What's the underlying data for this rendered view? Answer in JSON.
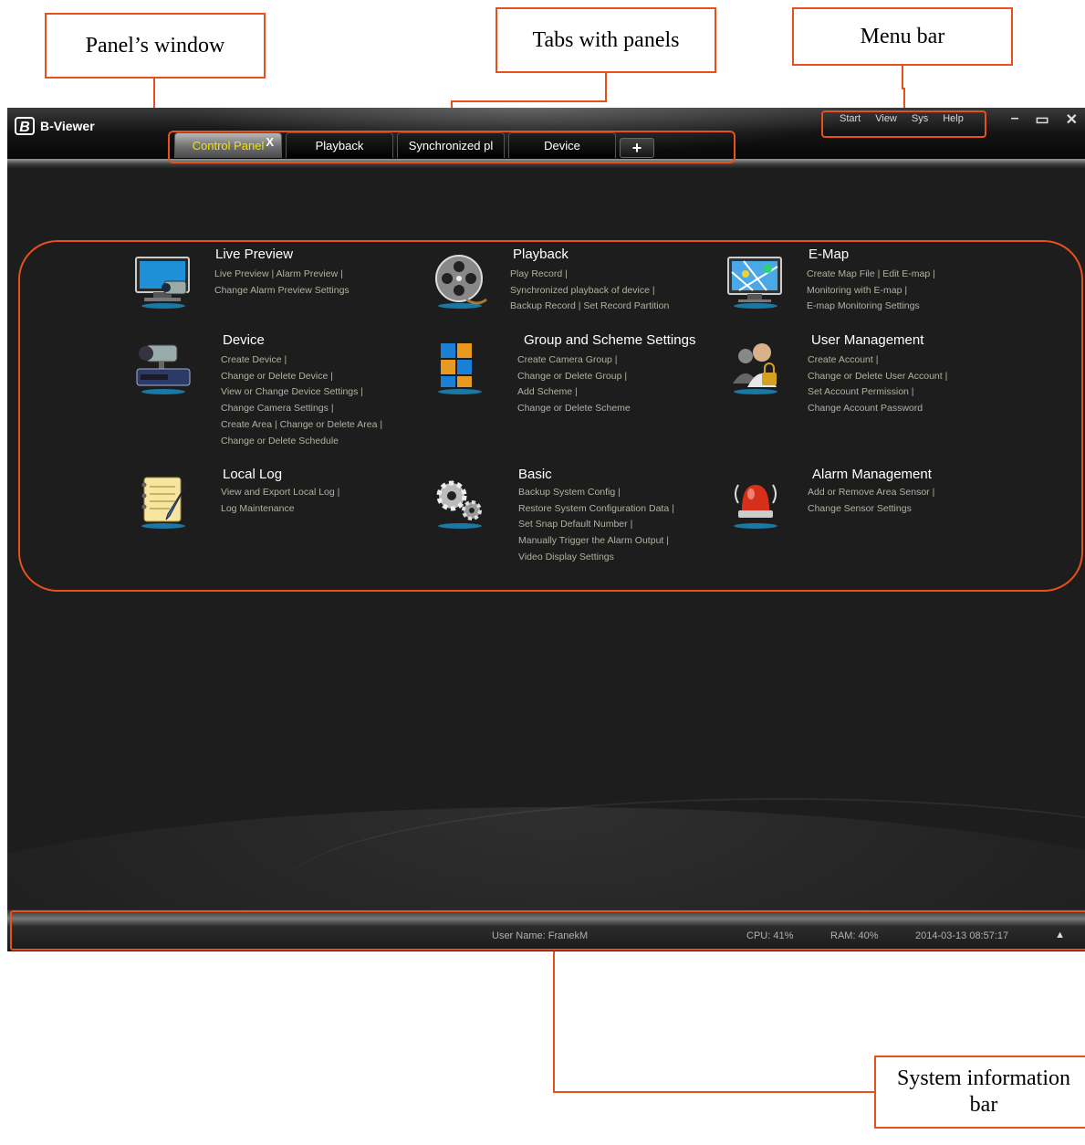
{
  "annotations": {
    "panel_window": "Panel’s window",
    "tabs": "Tabs with panels",
    "menu_bar": "Menu bar",
    "system_info_line1": "System information",
    "system_info_line2": "bar"
  },
  "app": {
    "logo_letter": "B",
    "title": "B-Viewer",
    "menu": [
      "Start",
      "View",
      "Sys",
      "Help"
    ],
    "window_controls": [
      "–",
      "▭",
      "✕"
    ],
    "tabs": [
      {
        "label": "Control Panel",
        "active": true,
        "close": "X"
      },
      {
        "label": "Playback"
      },
      {
        "label": "Synchronized pl"
      },
      {
        "label": "Device"
      }
    ],
    "add_tab": "+"
  },
  "modules": [
    {
      "title": "Live Preview",
      "icon": "monitor-camera-icon",
      "links": [
        "Live Preview  |  Alarm Preview  |",
        "Change Alarm Preview Settings"
      ]
    },
    {
      "title": "Playback",
      "icon": "film-reel-icon",
      "links": [
        "Play Record  |",
        "Synchronized playback of device  |",
        "Backup Record  |  Set Record Partition"
      ]
    },
    {
      "title": "E-Map",
      "icon": "map-monitor-icon",
      "links": [
        "Create Map File  |  Edit E-map  |",
        "Monitoring with E-map  |",
        "E-map Monitoring Settings"
      ]
    },
    {
      "title": "Device",
      "icon": "camera-device-icon",
      "links": [
        "Create Device  |",
        "Change or Delete Device  |",
        "View or Change Device Settings  |",
        "Change Camera Settings  |",
        "Create Area  |  Change or Delete Area  |",
        "Change or Delete Schedule"
      ]
    },
    {
      "title": "Group and Scheme Settings",
      "icon": "cubes-icon",
      "links": [
        "Create Camera Group  |",
        "Change or Delete Group  |",
        "Add Scheme  |",
        "Change or Delete Scheme"
      ]
    },
    {
      "title": "User Management",
      "icon": "users-lock-icon",
      "links": [
        "Create Account  |",
        "Change or Delete User Account  |",
        "Set Account Permission  |",
        "Change Account Password"
      ]
    },
    {
      "title": "Local Log",
      "icon": "notepad-icon",
      "links": [
        "View and Export Local Log  |",
        "Log Maintenance"
      ]
    },
    {
      "title": "Basic",
      "icon": "gears-icon",
      "links": [
        "Backup System Config  |",
        "Restore System Configuration Data  |",
        "Set Snap Default Number  |",
        "Manually Trigger the Alarm Output  |",
        "Video Display Settings"
      ]
    },
    {
      "title": "Alarm Management",
      "icon": "alarm-siren-icon",
      "links": [
        "Add or Remove Area Sensor  |",
        "Change Sensor Settings"
      ]
    }
  ],
  "status": {
    "user": "User Name: FranekM",
    "cpu": "CPU: 41%",
    "ram": "RAM: 40%",
    "datetime": "2014-03-13 08:57:17",
    "expand": "▲"
  },
  "colors": {
    "annotation": "#e8501e",
    "active_tab_text": "#f2e200",
    "link_text": "#b4b0a0"
  }
}
